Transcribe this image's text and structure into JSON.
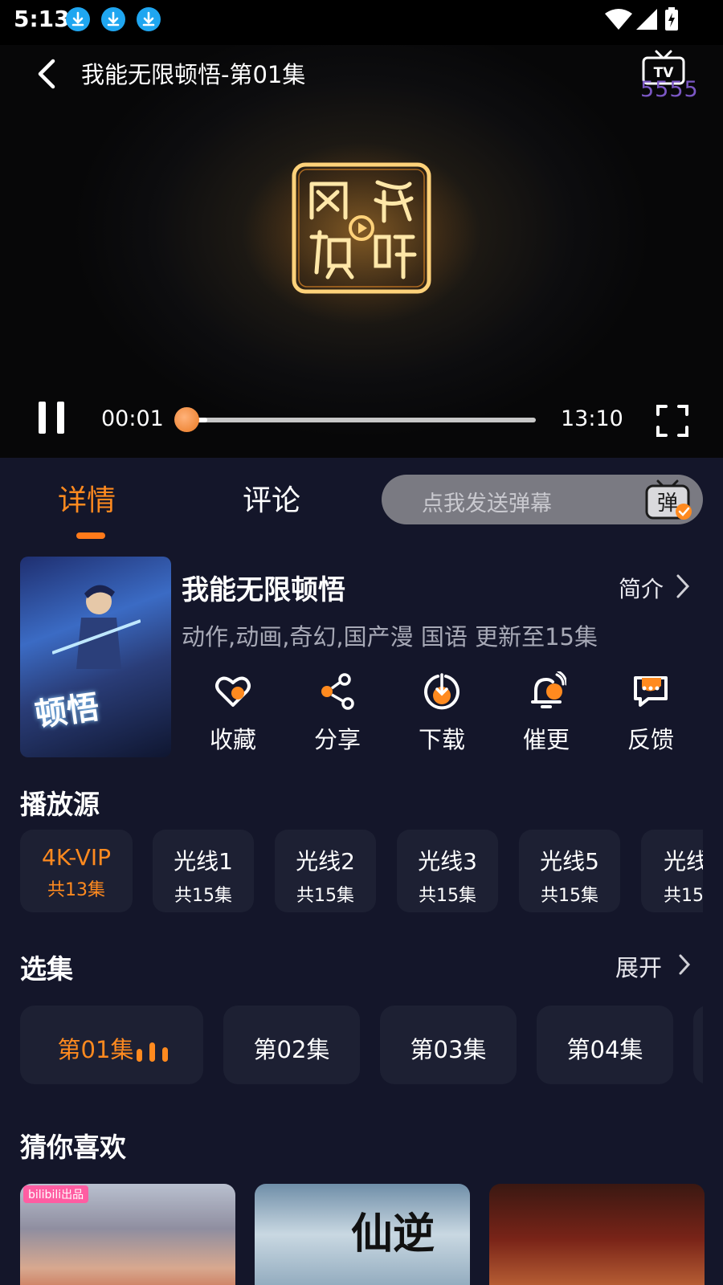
{
  "status_bar": {
    "time": "5:13",
    "icons": [
      "download-icon",
      "download-icon",
      "download-icon",
      "wifi-icon",
      "signal-icon",
      "battery-charging-icon"
    ]
  },
  "player": {
    "title": "我能无限顿悟-第01集",
    "tv_badge_number": "5555",
    "current_time": "00:01",
    "total_time": "13:10",
    "progress_fraction": 0.0013,
    "logo_icon": "network-video-logo"
  },
  "tabs": {
    "details": "详情",
    "comments": "评论"
  },
  "danmaku": {
    "placeholder": "点我发送弹幕",
    "button_glyph": "弹"
  },
  "show": {
    "title": "我能无限顿悟",
    "intro_link": "简介",
    "meta": "动作,动画,奇幻,国产漫 国语 更新至15集",
    "poster_caption": "顿悟"
  },
  "actions": [
    {
      "label": "收藏",
      "icon": "favorite-icon"
    },
    {
      "label": "分享",
      "icon": "share-icon"
    },
    {
      "label": "下载",
      "icon": "download-icon"
    },
    {
      "label": "催更",
      "icon": "remind-bell-icon"
    },
    {
      "label": "反馈",
      "icon": "feedback-icon"
    }
  ],
  "sources": {
    "title": "播放源",
    "items": [
      {
        "name": "4K-VIP",
        "count": "共13集"
      },
      {
        "name": "光线1",
        "count": "共15集"
      },
      {
        "name": "光线2",
        "count": "共15集"
      },
      {
        "name": "光线3",
        "count": "共15集"
      },
      {
        "name": "光线5",
        "count": "共15集"
      },
      {
        "name": "光线",
        "count": "共15"
      }
    ]
  },
  "episodes": {
    "title": "选集",
    "expand_label": "展开",
    "items": [
      "第01集",
      "第02集",
      "第03集",
      "第04集"
    ]
  },
  "recommend": {
    "title": "猜你喜欢",
    "badge": "bilibili出品",
    "art_text": "仙逆"
  },
  "colors": {
    "accent": "#ff8a1f",
    "background": "#14162a",
    "card": "#1d2033"
  }
}
